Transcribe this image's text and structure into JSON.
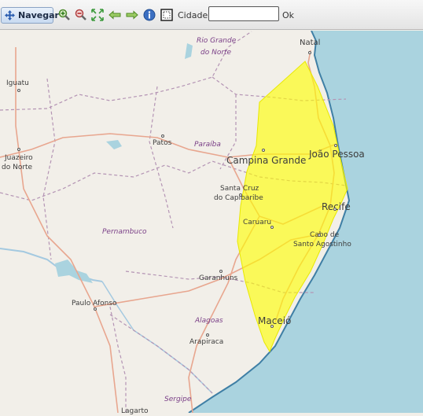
{
  "toolbar": {
    "navigate_label": "Navegar",
    "city_label": "Cidade:",
    "city_value": "",
    "ok_label": "Ok",
    "icons": [
      "move-icon",
      "zoom-in-icon",
      "zoom-out-icon",
      "zoom-extent-icon",
      "previous-view-icon",
      "next-view-icon",
      "info-icon",
      "select-box-icon"
    ]
  },
  "map": {
    "cities": [
      {
        "name": "Natal"
      },
      {
        "name": "João Pessoa"
      },
      {
        "name": "Recife"
      },
      {
        "name": "Campina Grande"
      },
      {
        "name": "Cabo de"
      },
      {
        "name": "Santo Agostinho"
      },
      {
        "name": "Caruaru"
      },
      {
        "name": "Santa Cruz"
      },
      {
        "name": "do Capibaribe"
      },
      {
        "name": "Garanhuns"
      },
      {
        "name": "Maceió"
      },
      {
        "name": "Arapiraca"
      },
      {
        "name": "Paulo Afonso"
      },
      {
        "name": "Patos"
      },
      {
        "name": "Iguatu"
      },
      {
        "name": "Juazeiro"
      },
      {
        "name": "do Norte"
      },
      {
        "name": "Lagarto"
      }
    ],
    "states": [
      "Rio Grande",
      "do Norte",
      "Paraíba",
      "Pernambuco",
      "Alagoas",
      "Sergipe"
    ],
    "colors": {
      "land": "#f2efe9",
      "ocean": "#aad3df",
      "alert_polygon": "#ffff00",
      "borders": "#b494b4",
      "roads": "#e8a68f"
    }
  }
}
